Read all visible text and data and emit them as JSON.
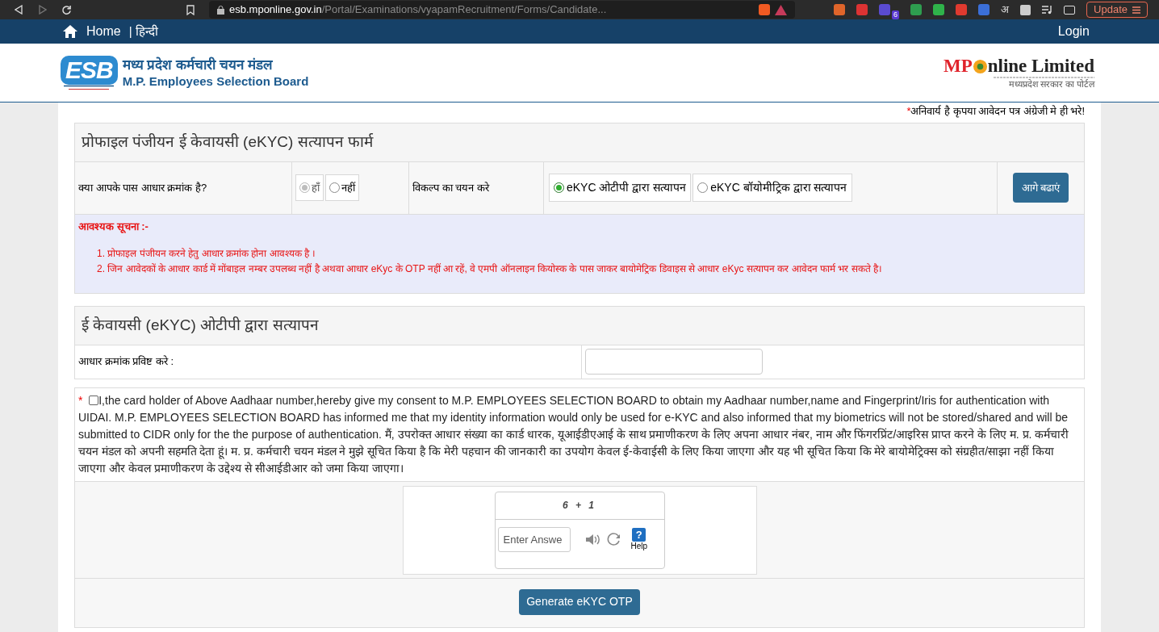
{
  "browser": {
    "url_host": "esb.mponline.gov.in",
    "url_path": "/Portal/Examinations/vyapamRecruitment/Forms/Candidate...",
    "extension_badge": "6",
    "extension_letter": "अ",
    "update_button": "Update"
  },
  "nav": {
    "home": "Home",
    "language": "| हिन्दी",
    "login": "Login"
  },
  "header": {
    "logo_letters": "ESB",
    "title_hindi": "मध्य प्रदेश कर्मचारी चयन मंडल",
    "title_english": "M.P. Employees Selection Board",
    "partner_mp": "MP",
    "partner_name": "nline Limited",
    "partner_hindi": "मध्यप्रदेश सरकार का पोर्टल"
  },
  "mandatory_note": {
    "mark": "*",
    "text": "अनिवार्य है कृपया आवेदन पत्र अंग्रेजी मे ही भरे!"
  },
  "profile_form": {
    "title": "प्रोफाइल पंजीयन ई केवायसी (eKYC) सत्यापन फार्म",
    "aadhaar_question": "क्या आपके पास आधार क्रमांक है?",
    "aadhaar_options": [
      {
        "label": "हाँ",
        "selected": true,
        "disabled": true
      },
      {
        "label": "नहीं",
        "selected": false,
        "disabled": false
      }
    ],
    "method_label": "विकल्प का चयन करे",
    "method_options": [
      {
        "label": "eKYC ओटीपी द्वारा सत्यापन",
        "selected": true
      },
      {
        "label": "eKYC बॉयोमीट्रिक द्वारा सत्यापन",
        "selected": false
      }
    ],
    "next_button": "आगे बढाएं"
  },
  "notice": {
    "heading": "आवश्यक सूचना :-",
    "items": [
      "1. प्रोफाइल पंजीयन करने हेतु आधार क्रमांक होना आवश्यक है ।",
      "2. जिन आवेदकों के आधार कार्ड में मोंबाइल नम्बर उपलब्ध नहीं है अथवा आधार eKyc के OTP नहीं आ रहें, वे एमपी ऑनलाइन कियोस्क के पास जाकर बायोमेट्रिक डिवाइस से आधार eKyc सत्यापन कर आवेदन फार्म भर सकते है।"
    ]
  },
  "otp_section": {
    "title": "ई केवायसी (eKYC) ओटीपी द्वारा सत्यापन",
    "aadhaar_label": "आधार क्रमांक प्रविष्ट करे :"
  },
  "consent": {
    "mark": "*",
    "checked": false,
    "text": "I,the card holder of Above Aadhaar number,hereby give my consent to M.P. EMPLOYEES SELECTION BOARD to obtain my Aadhaar number,name and Fingerprint/Iris for authentication with UIDAI. M.P. EMPLOYEES SELECTION BOARD has informed me that my identity information would only be used for e-KYC and also informed that my biometrics will not be stored/shared and will be submitted to CIDR only for the the purpose of authentication. मैं, उपरोक्त आधार संख्या का कार्ड धारक, यूआईडीएआई के साथ प्रमाणीकरण के लिए अपना आधार नंबर, नाम और फिंगरप्रिंट/आइरिस प्राप्त करने के लिए म. प्र. कर्मचारी चयन मंडल को अपनी सहमति देता हूं। म. प्र. कर्मचारी चयन मंडल ने मुझे सूचित किया है कि मेरी पहचान की जानकारी का उपयोग केवल ई-केवाईसी के लिए किया जाएगा और यह भी सूचित किया कि मेरे बायोमेट्रिक्स को संग्रहीत/साझा नहीं किया जाएगा और केवल प्रमाणीकरण के उद्देश्य से सीआईडीआर को जमा किया जाएगा।"
  },
  "captcha": {
    "question": "6 + 1",
    "placeholder": "Enter Answe",
    "help_mark": "?",
    "help_label": "Help"
  },
  "generate_button": "Generate eKYC OTP"
}
